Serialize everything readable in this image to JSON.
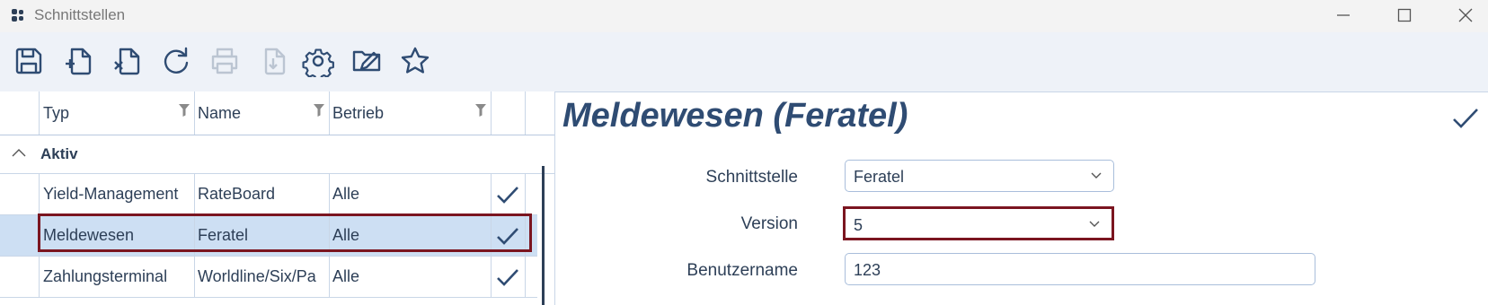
{
  "window": {
    "title": "Schnittstellen",
    "controls": {
      "minimize": "minimize-icon",
      "maximize": "maximize-icon",
      "close": "close-icon"
    }
  },
  "toolbar": {
    "buttons": [
      {
        "icon": "save-icon",
        "enabled": true
      },
      {
        "icon": "new-document-icon",
        "enabled": true
      },
      {
        "icon": "delete-document-icon",
        "enabled": true
      },
      {
        "icon": "refresh-icon",
        "enabled": true
      },
      {
        "icon": "print-icon",
        "enabled": false
      },
      {
        "icon": "download-icon",
        "enabled": false
      },
      {
        "icon": "settings-icon",
        "enabled": true
      },
      {
        "icon": "edit-folder-icon",
        "enabled": true
      },
      {
        "icon": "favorite-star-icon",
        "enabled": true
      }
    ]
  },
  "grid": {
    "columns": [
      "Typ",
      "Name",
      "Betrieb"
    ],
    "group": {
      "label": "Aktiv",
      "expanded": true
    },
    "rows": [
      {
        "typ": "Yield-Management",
        "name": "RateBoard",
        "betrieb": "Alle",
        "checked": true,
        "selected": false
      },
      {
        "typ": "Meldewesen",
        "name": "Feratel",
        "betrieb": "Alle",
        "checked": true,
        "selected": true
      },
      {
        "typ": "Zahlungsterminal",
        "name": "Worldline/Six/Pa",
        "betrieb": "Alle",
        "checked": true,
        "selected": false
      }
    ]
  },
  "detail": {
    "title": "Meldewesen (Feratel)",
    "fields": {
      "schnittstelle": {
        "label": "Schnittstelle",
        "value": "Feratel"
      },
      "version": {
        "label": "Version",
        "value": "5"
      },
      "benutzername": {
        "label": "Benutzername",
        "value": "123"
      }
    }
  },
  "colors": {
    "accent": "#2f4c73",
    "text": "#2d3f57",
    "selection": "#cddff3",
    "highlight_outline": "#7b1520",
    "toolbar_bg": "#eef2f8"
  }
}
